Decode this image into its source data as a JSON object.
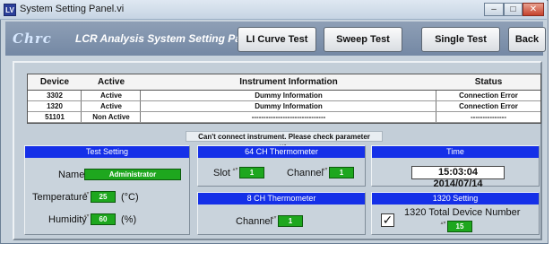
{
  "window": {
    "icon_text": "LV",
    "title": "System Setting Panel.vi",
    "minimize_symbol": "–",
    "maximize_symbol": "□",
    "close_symbol": "✕"
  },
  "header": {
    "logo_text": "Chrc",
    "app_title": "LCR Analysis System Setting Panel",
    "buttons": [
      "LI Curve Test",
      "Sweep Test",
      "Single Test",
      "Back"
    ]
  },
  "table": {
    "columns": [
      "Device",
      "Active",
      "Instrument Information",
      "Status"
    ],
    "rows": [
      [
        "3302",
        "Active",
        "Dummy Information",
        "Connection Error"
      ],
      [
        "1320",
        "Active",
        "Dummy Information",
        "Connection Error"
      ],
      [
        "51101",
        "Non Active",
        "-------------------------------",
        "---------------"
      ]
    ]
  },
  "alert_message": "Can't connect instrument. Please check parameter setting.",
  "test_setting": {
    "title": "Test Setting",
    "name_label": "Name",
    "name_value": "Administrator",
    "temperature_label": "Temperature",
    "temperature_value": "25",
    "temperature_unit": "(°C)",
    "humidity_label": "Humidity",
    "humidity_value": "60",
    "humidity_unit": "(%)"
  },
  "thermo64": {
    "title": "64 CH Thermometer",
    "slot_label": "Slot",
    "slot_value": "1",
    "channel_label": "Channel",
    "channel_value": "1"
  },
  "thermo8": {
    "title": "8 CH Thermometer",
    "channel_label": "Channel",
    "channel_value": "1"
  },
  "time": {
    "title": "Time",
    "value": "15:03:04  2014/07/14"
  },
  "setting1320": {
    "title": "1320 Setting",
    "checkbox_symbol": "✓",
    "device_number_label": "1320 Total Device Number",
    "device_number_value": "15"
  },
  "spinner_symbol": "▴▾",
  "colors": {
    "group_header": "#1530e8",
    "numeric_field": "#1ea71e",
    "header_bar": "#7f92ad"
  }
}
